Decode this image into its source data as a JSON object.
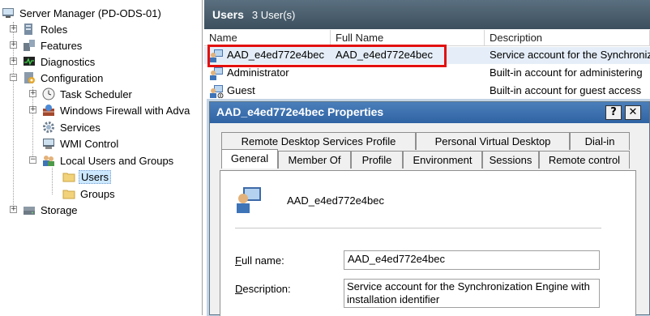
{
  "tree": {
    "root": "Server Manager (PD-ODS-01)",
    "roles": "Roles",
    "features": "Features",
    "diagnostics": "Diagnostics",
    "configuration": "Configuration",
    "task_scheduler": "Task Scheduler",
    "firewall": "Windows Firewall with Adva",
    "services": "Services",
    "wmi": "WMI Control",
    "local_users": "Local Users and Groups",
    "users": "Users",
    "groups": "Groups",
    "storage": "Storage"
  },
  "users_pane": {
    "title": "Users",
    "count": "3 User(s)",
    "columns": [
      "Name",
      "Full Name",
      "Description"
    ],
    "rows": [
      {
        "name": "AAD_e4ed772e4bec",
        "full_name": "AAD_e4ed772e4bec",
        "description": "Service account for the Synchronization Engine"
      },
      {
        "name": "Administrator",
        "full_name": "",
        "description": "Built-in account for administering"
      },
      {
        "name": "Guest",
        "full_name": "",
        "description": "Built-in account for guest access"
      }
    ]
  },
  "dialog": {
    "title": "AAD_e4ed772e4bec Properties",
    "help_label": "?",
    "close_label": "✕",
    "tabs_top": [
      "Remote Desktop Services Profile",
      "Personal Virtual Desktop",
      "Dial-in"
    ],
    "tabs_bottom": [
      "General",
      "Member Of",
      "Profile",
      "Environment",
      "Sessions",
      "Remote control"
    ],
    "username": "AAD_e4ed772e4bec",
    "full_name_label_accel": "F",
    "full_name_label_rest": "ull name:",
    "full_name_value": "AAD_e4ed772e4bec",
    "description_label_accel": "D",
    "description_label_rest": "escription:",
    "description_value": "Service account for the Synchronization Engine with installation identifier"
  },
  "colors": {
    "highlight_box": "#e3100f",
    "title_bar": "#2f63a3",
    "header_bar": "#3c4f5e"
  }
}
